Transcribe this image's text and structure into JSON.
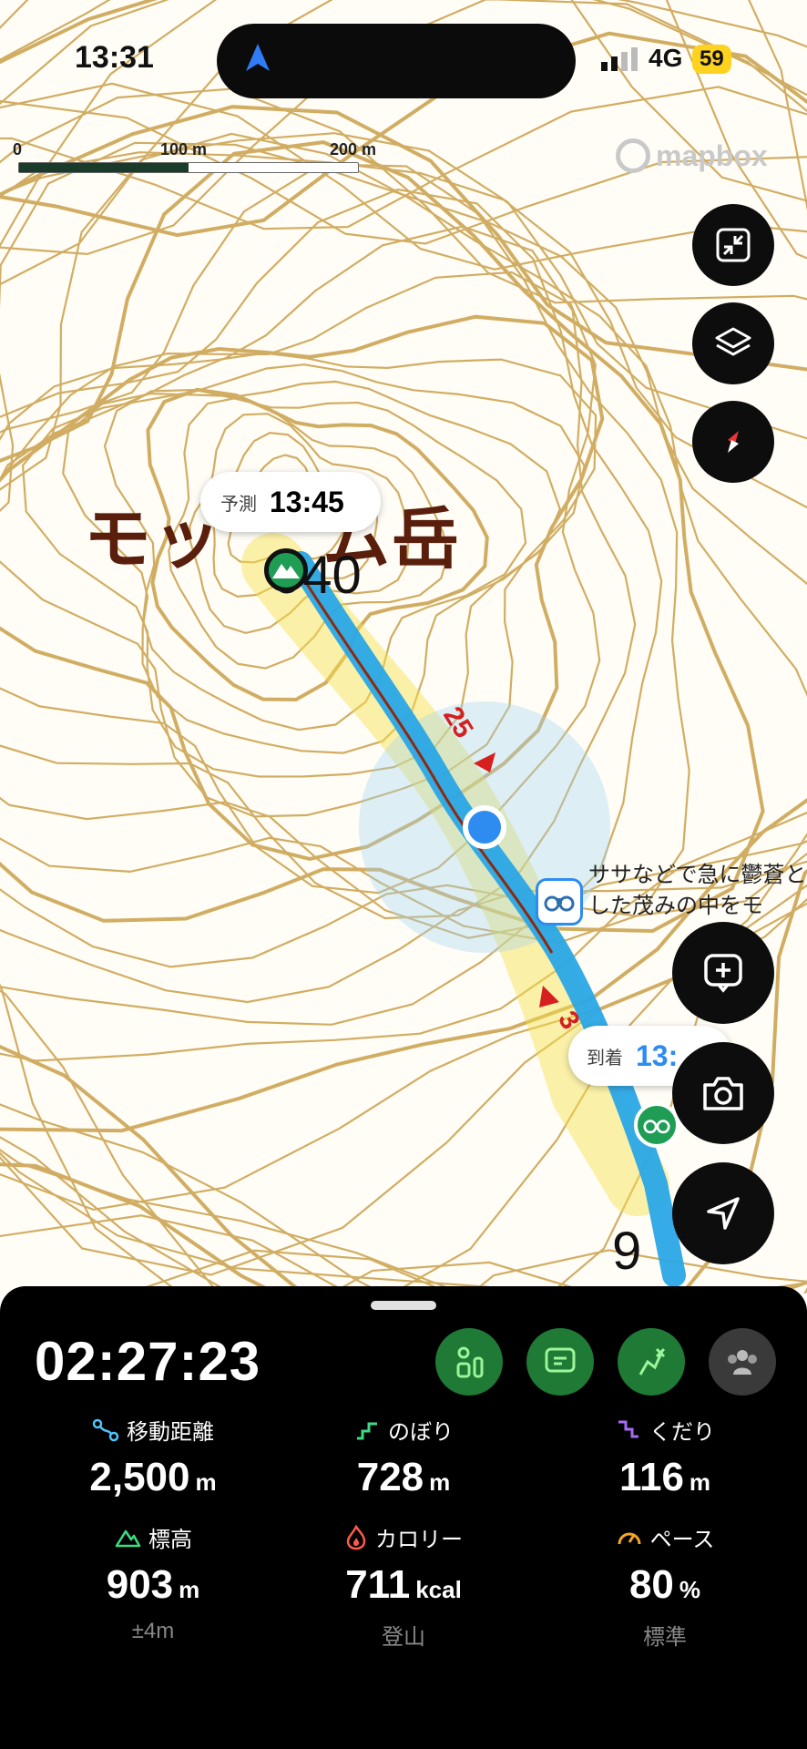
{
  "status_bar": {
    "time": "13:31",
    "network": "4G",
    "battery": "59"
  },
  "scale": {
    "ticks": [
      "0",
      "100 m",
      "200 m"
    ]
  },
  "attribution": "mapbox",
  "map": {
    "peak_name": "モッ",
    "peak_name_tail": "ム岳",
    "peak_elevation": "940",
    "second_elevation": "9",
    "forecast": {
      "label": "予測",
      "time": "13:45"
    },
    "arrival": {
      "label": "到着",
      "time": "13:"
    },
    "note": "ササなどで急に鬱蒼とした茂みの中をモ",
    "route_marks": [
      "25",
      "3"
    ],
    "colors": {
      "contour": "#c9a04a",
      "route": "#2aa6e6",
      "track": "#8b2a10",
      "highlight": "#f5e04a"
    }
  },
  "map_controls": {
    "expand_icon": "expand-icon",
    "layers_icon": "layers-icon",
    "compass_icon": "compass-icon",
    "add_note_icon": "add-note-icon",
    "camera_icon": "camera-icon",
    "locate_icon": "navigation-arrow-icon"
  },
  "panel": {
    "elapsed": "02:27:23",
    "stats": [
      {
        "label": "移動距離",
        "value": "2,500",
        "unit": "m",
        "sub": ""
      },
      {
        "label": "のぼり",
        "value": "728",
        "unit": "m",
        "sub": ""
      },
      {
        "label": "くだり",
        "value": "116",
        "unit": "m",
        "sub": ""
      },
      {
        "label": "標高",
        "value": "903",
        "unit": "m",
        "sub": "±4m"
      },
      {
        "label": "カロリー",
        "value": "711",
        "unit": "kcal",
        "sub": "登山"
      },
      {
        "label": "ペース",
        "value": "80",
        "unit": "%",
        "sub": "標準"
      }
    ]
  }
}
